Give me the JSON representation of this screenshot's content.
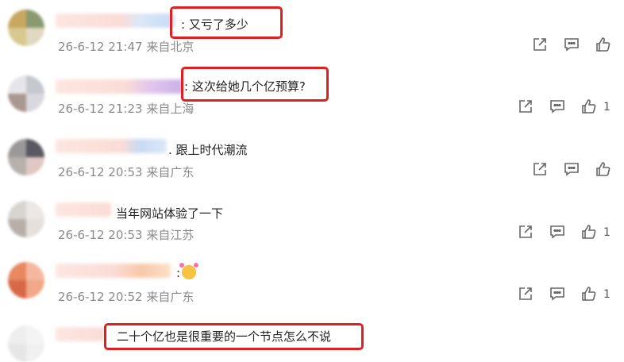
{
  "comments": [
    {
      "text": ": 又亏了多少",
      "time": "26-6-12 21:47",
      "location": "来自北京",
      "likes": ""
    },
    {
      "text": ": 这次给她几个亿预算?",
      "time": "26-6-12 21:23",
      "location": "来自上海",
      "likes": "1"
    },
    {
      "text": ". 跟上时代潮流",
      "time": "26-6-12 20:53",
      "location": "来自广东",
      "likes": ""
    },
    {
      "text": "当年网站体验了一下",
      "time": "26-6-12 20:53",
      "location": "来自江苏",
      "likes": "1"
    },
    {
      "text": ":",
      "time": "26-6-12 20:52",
      "location": "来自广东",
      "likes": "1"
    },
    {
      "text": "二十个亿也是很重要的一个节点怎么不说",
      "time": "",
      "location": "",
      "likes": ""
    }
  ],
  "icons": {
    "share": "share-icon",
    "reply": "comment-icon",
    "like": "like-icon",
    "emoji": "flushed-face-emoji"
  },
  "colors": {
    "highlight": "#e02020",
    "meta": "#8a8a8a"
  }
}
